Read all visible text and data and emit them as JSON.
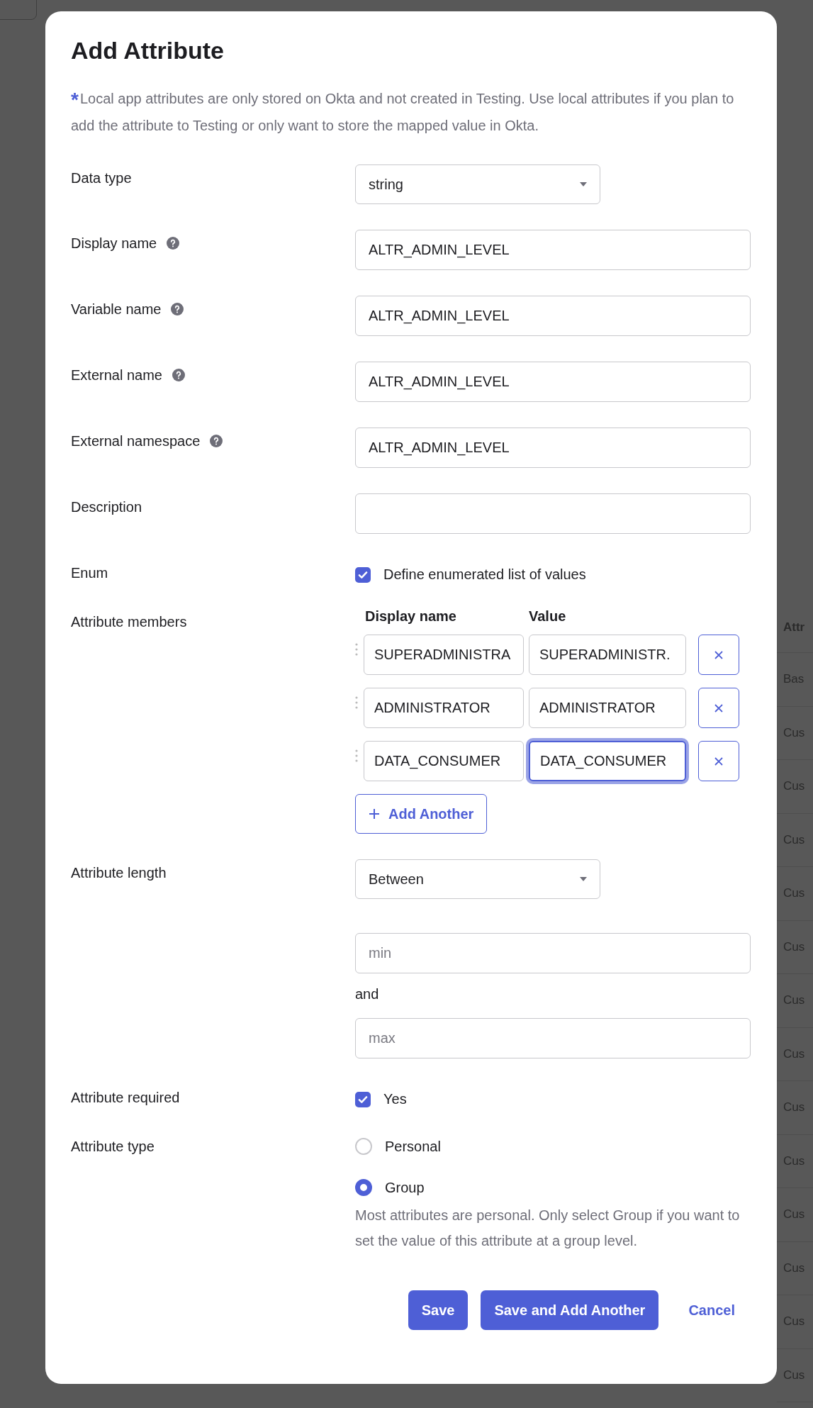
{
  "background": {
    "table_header": "Attr",
    "table_rows": [
      "Bas",
      "Cus",
      "Cus",
      "Cus",
      "Cus",
      "Cus",
      "Cus",
      "Cus",
      "Cus",
      "Cus",
      "Cus",
      "Cus",
      "Cus",
      "Cus"
    ]
  },
  "dialog": {
    "title": "Add Attribute",
    "note_mark": "*",
    "note": "Local app attributes are only stored on Okta and not created in Testing. Use local attributes if you plan to add the attribute to Testing or only want to store the mapped value in Okta.",
    "fields": [
      {
        "kind": "select",
        "label": "Data type",
        "help": false,
        "value": "string"
      },
      {
        "kind": "text",
        "label": "Display name",
        "help": true,
        "value": "ALTR_ADMIN_LEVEL"
      },
      {
        "kind": "text",
        "label": "Variable name",
        "help": true,
        "value": "ALTR_ADMIN_LEVEL"
      },
      {
        "kind": "text",
        "label": "External name",
        "help": true,
        "value": "ALTR_ADMIN_LEVEL"
      },
      {
        "kind": "text",
        "label": "External namespace",
        "help": true,
        "value": "ALTR_ADMIN_LEVEL"
      },
      {
        "kind": "text",
        "label": "Description",
        "help": false
      },
      {
        "kind": "checkbox",
        "label": "Enum",
        "checked": true,
        "text": "Define enumerated list of values"
      }
    ],
    "members": {
      "label": "Attribute members",
      "columns": [
        "Display name",
        "Value"
      ],
      "rows": [
        {
          "display_name": "SUPERADMINISTRA",
          "value": "SUPERADMINISTR.",
          "focused": false
        },
        {
          "display_name": "ADMINISTRATOR",
          "value": "ADMINISTRATOR",
          "focused": false
        },
        {
          "display_name": "DATA_CONSUMER",
          "value": "DATA_CONSUMER",
          "focused": true
        }
      ],
      "add_button": "Add Another"
    },
    "length": {
      "label": "Attribute length",
      "value": "Between",
      "min_placeholder": "min",
      "joiner": "and",
      "max_placeholder": "max"
    },
    "required": {
      "label": "Attribute required",
      "checked": true,
      "text": "Yes"
    },
    "type": {
      "label": "Attribute type",
      "options": [
        {
          "label": "Personal",
          "selected": false
        },
        {
          "label": "Group",
          "selected": true
        }
      ],
      "hint": "Most attributes are personal. Only select Group if you want to set the value of this attribute at a group level."
    },
    "buttons": [
      {
        "kind": "primary",
        "label": "Save"
      },
      {
        "kind": "primary",
        "label": "Save and Add Another"
      },
      {
        "kind": "link",
        "label": "Cancel"
      }
    ]
  }
}
